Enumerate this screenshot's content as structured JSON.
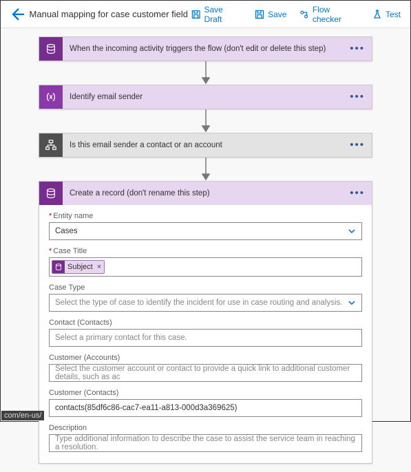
{
  "header": {
    "title": "Manual mapping for case customer field",
    "buttons": {
      "save_draft": "Save Draft",
      "save": "Save",
      "flow_checker": "Flow checker",
      "test": "Test"
    }
  },
  "steps": {
    "trigger": {
      "title": "When the incoming activity triggers the flow (don't edit or delete this step)"
    },
    "identify": {
      "title": "Identify email sender"
    },
    "condition": {
      "title": "Is this email sender a contact or an account"
    },
    "create": {
      "title": "Create a record (don't rename this step)"
    }
  },
  "form": {
    "entity_name": {
      "label": "Entity name",
      "value": "Cases"
    },
    "case_title": {
      "label": "Case Title",
      "token": "Subject"
    },
    "case_type": {
      "label": "Case Type",
      "placeholder": "Select the type of case to identify the incident for use in case routing and analysis."
    },
    "contact": {
      "label": "Contact (Contacts)",
      "placeholder": "Select a primary contact for this case."
    },
    "customer_accounts": {
      "label": "Customer (Accounts)",
      "placeholder": "Select the customer account or contact to provide a quick link to additional customer details, such as ac"
    },
    "customer_contacts": {
      "label": "Customer (Contacts)",
      "value": "contacts(85df6c86-cac7-ea11-a813-000d3a369625)"
    },
    "description": {
      "label": "Description",
      "placeholder": "Type additional information to describe the case to assist the service team in reaching a resolution."
    }
  },
  "footer_hint": "com/en-us/"
}
